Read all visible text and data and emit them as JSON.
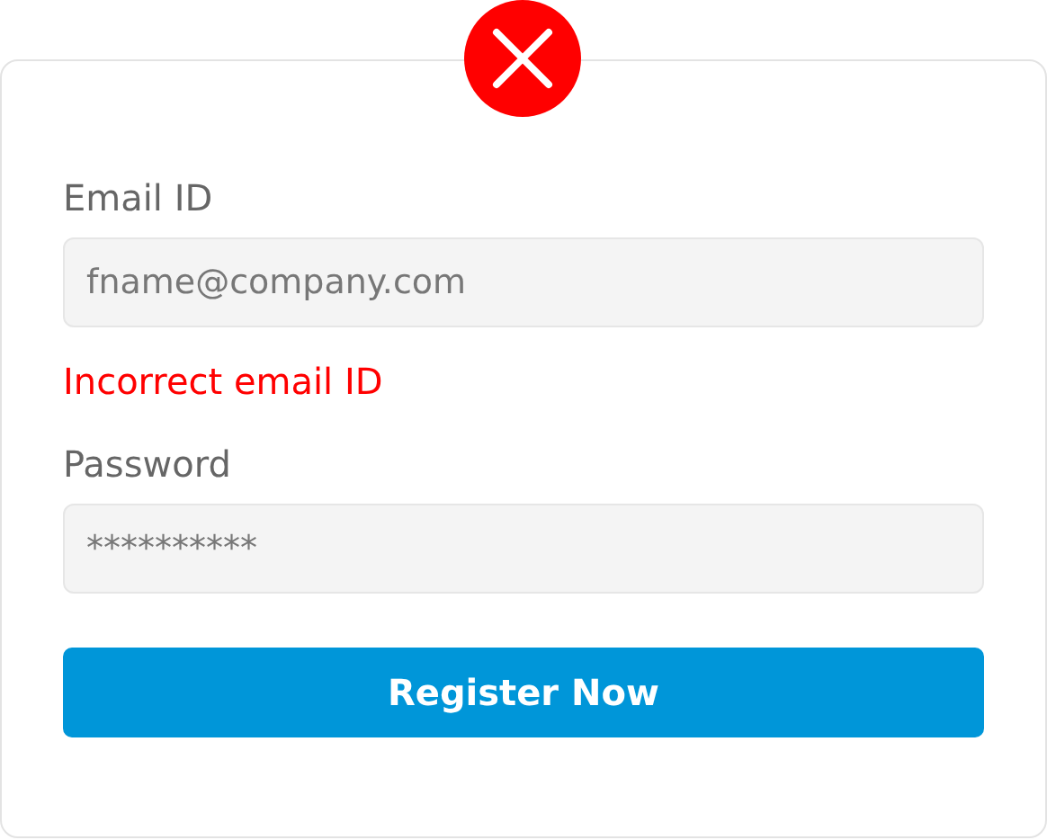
{
  "form": {
    "status": {
      "kind": "error"
    },
    "fields": [
      {
        "label": "Email ID",
        "value": "fname@company.com",
        "error": "Incorrect email ID"
      },
      {
        "label": "Password",
        "value": "**********"
      }
    ],
    "submit": "Register Now"
  }
}
